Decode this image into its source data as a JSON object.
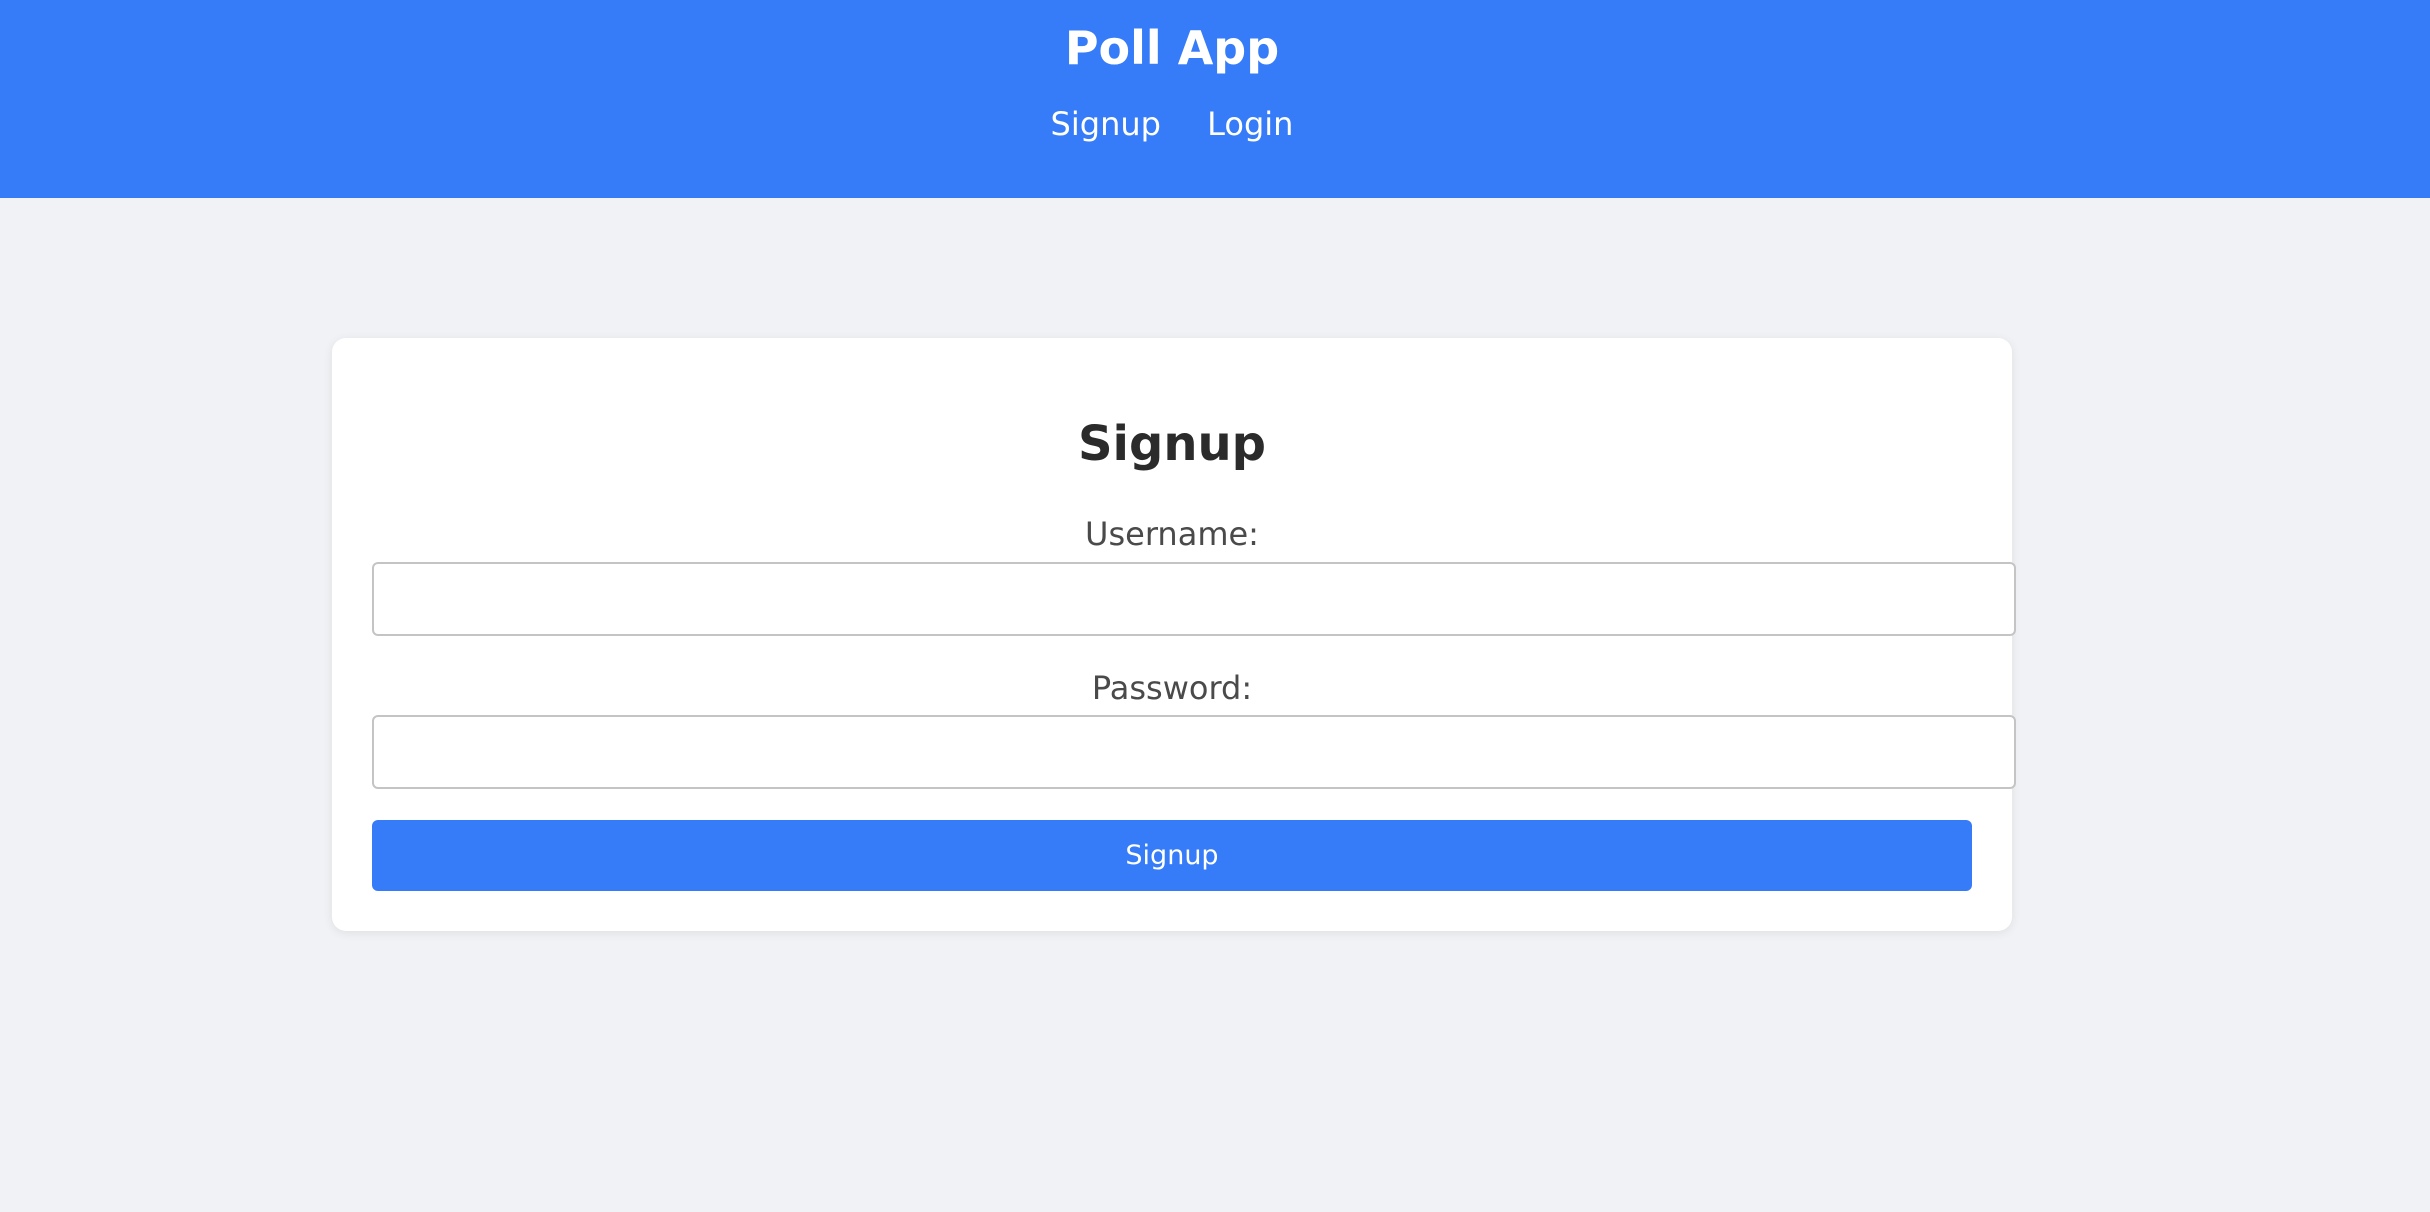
{
  "header": {
    "title": "Poll App",
    "nav": {
      "signup": "Signup",
      "login": "Login"
    },
    "bg_color": "#367bf7"
  },
  "form": {
    "title": "Signup",
    "username_label": "Username:",
    "username_value": "",
    "password_label": "Password:",
    "password_value": "",
    "submit_label": "Signup",
    "button_color": "#367bf7"
  }
}
